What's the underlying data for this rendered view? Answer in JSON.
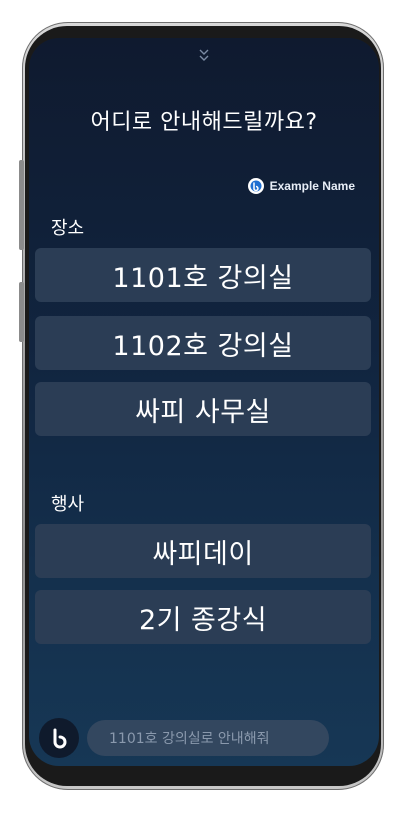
{
  "assistant": {
    "prompt": "어디로 안내해드릴까요?",
    "user_name": "Example Name"
  },
  "sections": {
    "places": {
      "label": "장소",
      "items": [
        "1101호 강의실",
        "1102호 강의실",
        "싸피 사무실"
      ]
    },
    "events": {
      "label": "행사",
      "items": [
        "싸피데이",
        "2기 종강식"
      ]
    }
  },
  "input": {
    "text": "1101호 강의실로 안내해줘"
  },
  "icons": {
    "handle": "chevron-double-down-icon",
    "profile": "bixby-profile-icon",
    "assistant": "bixby-icon"
  },
  "colors": {
    "screen_top": "#0f1a2f",
    "screen_bottom": "#163755",
    "option_bg": "#2b3d55",
    "input_bg": "#33475f"
  }
}
